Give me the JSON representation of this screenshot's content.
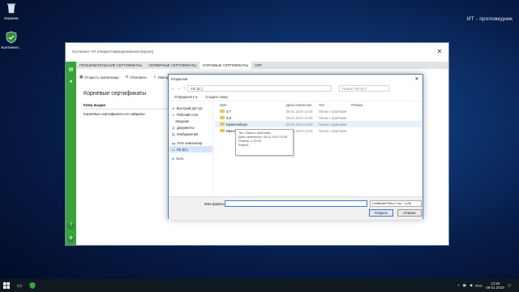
{
  "desktop": {
    "icons": [
      {
        "label": "Корзина"
      },
      {
        "label": "Континент..."
      }
    ],
    "watermark": "ИТ - проповедник"
  },
  "app": {
    "title": "Континент-АП (неидентифицированная версия)",
    "tabs": [
      "ПОЛЬЗОВАТЕЛЬСКИЕ СЕРТИФИКАТЫ",
      "СЕРВЕРНЫЕ СЕРТИФИКАТЫ",
      "КОРНЕВЫЕ СЕРТИФИКАТЫ",
      "CDP"
    ],
    "active_tab": 2,
    "toolbar": {
      "open_store": "Открыть хранилище",
      "refresh": "Обновить",
      "import": "Импорт"
    },
    "heading": "Корневые сертификаты",
    "table_header": "Кому выдан",
    "empty_row": "Корневые сертификаты не найдены"
  },
  "dialog": {
    "title": "Открытие",
    "path": "FD (E:)",
    "search_placeholder": "Поиск: FD (E:)",
    "organize": "Упорядочить ▾",
    "new_folder": "Создать папку",
    "nav": [
      {
        "label": "Быстрый доступ",
        "icon": "star-icon"
      },
      {
        "label": "Рабочий стол",
        "icon": "desktop-icon"
      },
      {
        "label": "Загрузки",
        "icon": "download-icon"
      },
      {
        "label": "Документы",
        "icon": "documents-icon"
      },
      {
        "label": "Изображения",
        "icon": "images-icon"
      },
      {
        "label": "Этот компьютер",
        "icon": "computer-icon"
      },
      {
        "label": "FD (E:)",
        "icon": "drive-icon"
      },
      {
        "label": "Сеть",
        "icon": "network-icon"
      }
    ],
    "columns": [
      "Имя",
      "Дата изменения",
      "Тип",
      "Размер"
    ],
    "files": [
      {
        "name": "3.7",
        "date": "08.01.2019 13:35",
        "type": "Папка с файлами",
        "size": ""
      },
      {
        "name": "3.8",
        "date": "08.01.2019 13:35",
        "type": "Папка с файлами",
        "size": ""
      },
      {
        "name": "topsecretkeys",
        "date": "08.01.2019 13:35",
        "type": "Папка с файлами",
        "size": ""
      },
      {
        "name": "Иванов",
        "date": "08.01.2019 13:35",
        "type": "Папка с файлами",
        "size": ""
      }
    ],
    "tooltip": [
      "Тип: Папка с файлами",
      "Дата изменения: 08.01.2019 13:35",
      "Размер: 1,29 КБ",
      "Файлы:"
    ],
    "filename_label": "Имя файла:",
    "filename_value": "",
    "filter": "Certificate Files (*.cer, *.p7b)",
    "open": "Открыть",
    "cancel": "Отмена"
  },
  "taskbar": {
    "lang": "РУС",
    "time": "13:36",
    "date": "09.01.2019"
  },
  "colors": {
    "accent_green": "#3aa43c",
    "selection": "#d7e6f7",
    "focus_blue": "#3b7ad8"
  }
}
